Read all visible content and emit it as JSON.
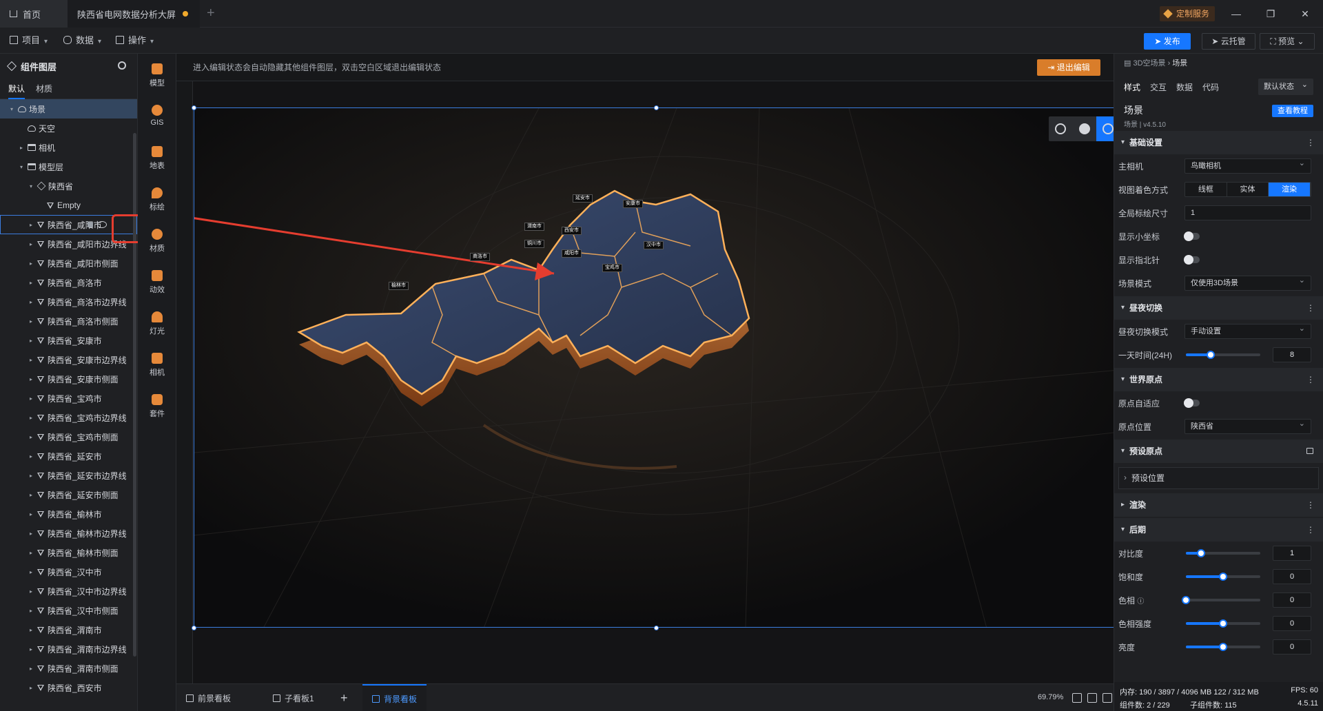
{
  "titlebar": {
    "home_tab": "首页",
    "active_tab": "陕西省电网数据分析大屏",
    "custom_service": "定制服务"
  },
  "menubar": {
    "project": "项目",
    "data": "数据",
    "operate": "操作",
    "publish": "发布",
    "cloud": "云托管",
    "preview": "预览"
  },
  "layer_panel": {
    "title": "组件图层",
    "tabs": [
      "默认",
      "材质"
    ],
    "nodes": [
      "场景",
      "天空",
      "相机",
      "模型层",
      "陕西省",
      "Empty",
      "陕西省_咸阳市",
      "陕西省_咸阳市边界线",
      "陕西省_咸阳市侧面",
      "陕西省_商洛市",
      "陕西省_商洛市边界线",
      "陕西省_商洛市侧面",
      "陕西省_安康市",
      "陕西省_安康市边界线",
      "陕西省_安康市侧面",
      "陕西省_宝鸡市",
      "陕西省_宝鸡市边界线",
      "陕西省_宝鸡市侧面",
      "陕西省_延安市",
      "陕西省_延安市边界线",
      "陕西省_延安市侧面",
      "陕西省_榆林市",
      "陕西省_榆林市边界线",
      "陕西省_榆林市侧面",
      "陕西省_汉中市",
      "陕西省_汉中市边界线",
      "陕西省_汉中市侧面",
      "陕西省_渭南市",
      "陕西省_渭南市边界线",
      "陕西省_渭南市侧面",
      "陕西省_西安市"
    ]
  },
  "component_toolbar": [
    "模型",
    "GIS",
    "地表",
    "标绘",
    "材质",
    "动效",
    "灯光",
    "相机",
    "套件"
  ],
  "canvas": {
    "hint": "进入编辑状态会自动隐藏其他组件图层，双击空白区域退出编辑状态",
    "exit_edit": "退出编辑",
    "map_labels": [
      "延安市",
      "安康市",
      "渭南市",
      "西安市",
      "铜川市",
      "咸阳市",
      "汉中市",
      "宝鸡市",
      "榆林市",
      "商洛市"
    ]
  },
  "bottombar": {
    "tabs": [
      "前景看板",
      "子看板1",
      "背景看板"
    ],
    "zoom": "69.79%"
  },
  "props": {
    "breadcrumb_root": "3D空场景",
    "breadcrumb_leaf": "场景",
    "tabs": [
      "样式",
      "交互",
      "数据",
      "代码"
    ],
    "state": "默认状态",
    "title": "场景",
    "version": "场景 | v4.5.10",
    "tutorial": "查看教程",
    "sections": {
      "basic": "基础设置",
      "daynight": "昼夜切换",
      "origin": "世界原点",
      "preset": "预设原点",
      "render": "渲染",
      "post": "后期"
    },
    "basic": {
      "camera_label": "主相机",
      "camera_value": "鸟瞰相机",
      "shading_label": "视图着色方式",
      "shading_options": [
        "线框",
        "实体",
        "渲染"
      ],
      "shading_selected": "渲染",
      "scale_label": "全局标绘尺寸",
      "scale_value": "1",
      "axis_label": "显示小坐标",
      "compass_label": "显示指北针",
      "mode_label": "场景模式",
      "mode_value": "仅使用3D场景"
    },
    "daynight": {
      "mode_label": "昼夜切换模式",
      "mode_value": "手动设置",
      "time_label": "一天时间(24H)",
      "time_value": "8",
      "time_fraction": 0.33
    },
    "origin": {
      "auto_label": "原点自适应",
      "pos_label": "原点位置",
      "pos_value": "陕西省"
    },
    "preset_pos": "预设位置",
    "post": {
      "contrast_label": "对比度",
      "contrast_value": "1",
      "contrast_fraction": 0.2,
      "saturation_label": "饱和度",
      "saturation_value": "0",
      "saturation_fraction": 0.5,
      "hue_label": "色相",
      "hue_value": "0",
      "hue_fraction": 0.0,
      "hue_strength_label": "色相强度",
      "hue_strength_value": "0",
      "hue_strength_fraction": 0.5,
      "brightness_label": "亮度",
      "brightness_value": "0",
      "brightness_fraction": 0.5
    },
    "status": {
      "memory": "内存: 190 / 3897 / 4096 MB  122 / 312 MB",
      "fps": "FPS: 60",
      "components": "组件数: 2 / 229",
      "sub_components": "子组件数: 115",
      "version": "4.5.11"
    }
  }
}
